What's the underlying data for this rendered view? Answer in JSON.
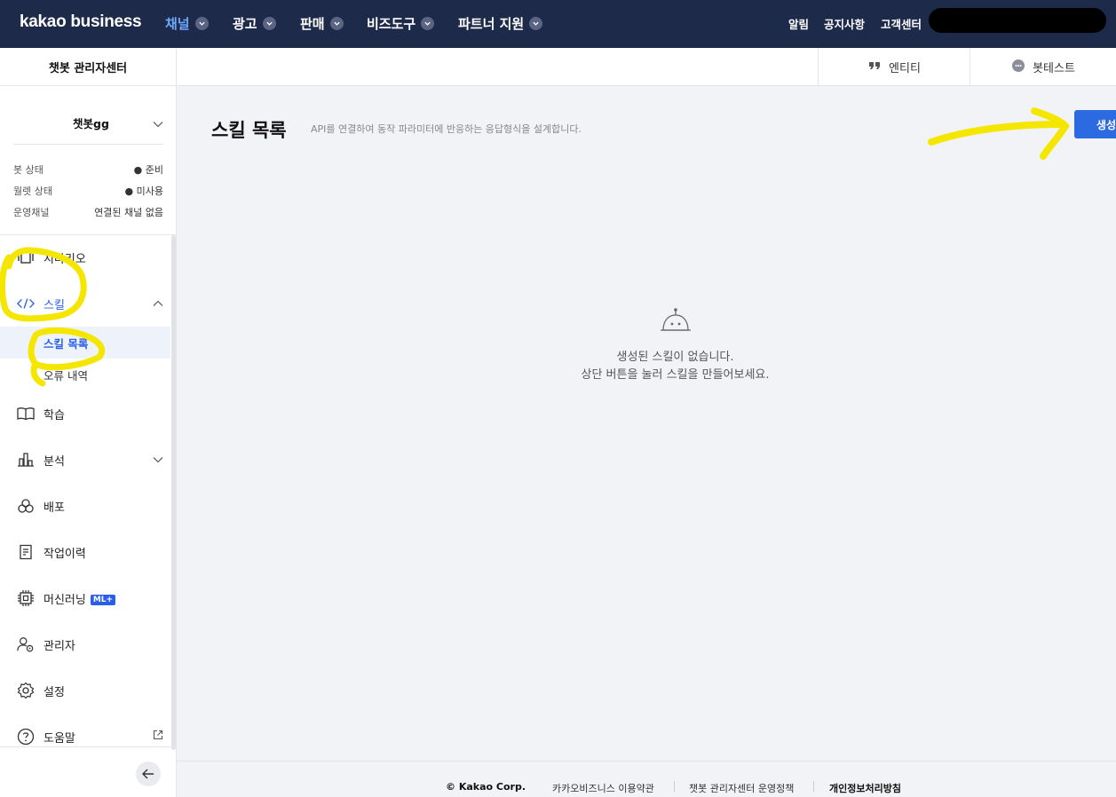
{
  "topnav": {
    "logo": "kakao business",
    "items": [
      {
        "label": "채널",
        "active": true
      },
      {
        "label": "광고"
      },
      {
        "label": "판매"
      },
      {
        "label": "비즈도구"
      },
      {
        "label": "파트너 지원"
      }
    ],
    "right": [
      "알림",
      "공지사항",
      "고객센터"
    ]
  },
  "subheader": {
    "title": "챗봇 관리자센터",
    "tabs": [
      {
        "label": "엔티티",
        "icon": "quote-icon"
      },
      {
        "label": "봇테스트",
        "icon": "chat-bubble-icon"
      }
    ]
  },
  "sidebar": {
    "bot_name": "챗봇gg",
    "status": [
      {
        "label": "봇 상태",
        "value": "● 준비"
      },
      {
        "label": "월렛 상태",
        "value": "● 미사용"
      },
      {
        "label": "운영채널",
        "value": "연결된 채널 없음"
      }
    ],
    "menu": [
      {
        "label": "시나리오",
        "icon": "scenario-icon"
      },
      {
        "label": "스킬",
        "icon": "code-icon",
        "expanded": true
      },
      {
        "label": "스킬 목록",
        "sub": true,
        "active": true
      },
      {
        "label": "오류 내역",
        "sub": true
      },
      {
        "label": "학습",
        "icon": "book-icon"
      },
      {
        "label": "분석",
        "icon": "chart-icon"
      },
      {
        "label": "배포",
        "icon": "deploy-icon"
      },
      {
        "label": "작업이력",
        "icon": "history-icon"
      },
      {
        "label": "머신러닝",
        "icon": "chip-icon",
        "badge": "ML+"
      },
      {
        "label": "관리자",
        "icon": "admin-icon"
      },
      {
        "label": "설정",
        "icon": "gear-icon"
      },
      {
        "label": "도움말",
        "icon": "help-icon"
      }
    ]
  },
  "main": {
    "title": "스킬 목록",
    "description": "API를 연결하여 동작 파라미터에 반응하는 응답형식을 설계합니다.",
    "create_button": "생성",
    "empty_line1": "생성된 스킬이 없습니다.",
    "empty_line2": "상단 버튼을 눌러 스킬을 만들어보세요."
  },
  "footer": {
    "copyright": "© Kakao Corp.",
    "links": [
      "카카오비즈니스 이용약관",
      "챗봇 관리자센터 운영정책",
      "개인정보처리방침"
    ]
  },
  "colors": {
    "topbar": "#1e2a4a",
    "accent": "#2b5ee8",
    "highlight": "#f5e600"
  }
}
